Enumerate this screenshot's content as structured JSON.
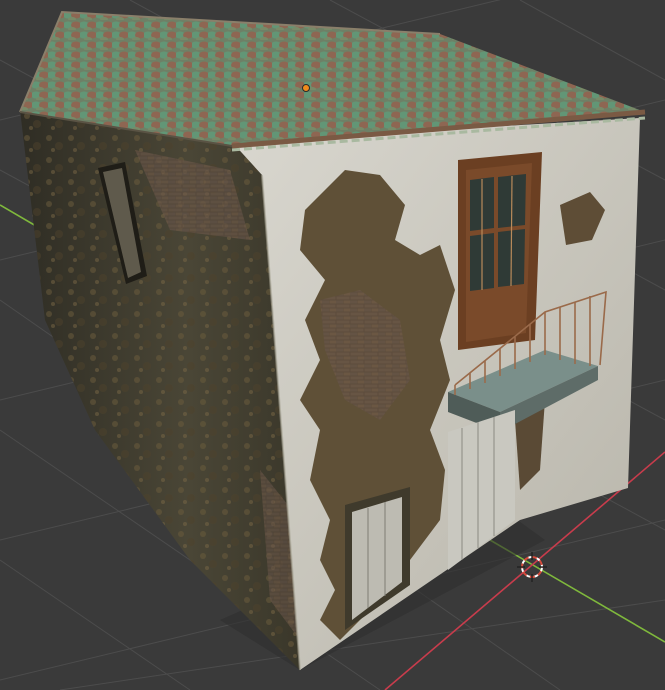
{
  "viewport": {
    "background": "#3a3a3a",
    "grid_color": "#4a4a4a",
    "x_axis_color": "#c83c4c",
    "y_axis_color": "#7fb83c"
  },
  "model": {
    "roof_color": "#6d8c6e",
    "wall_color": "#cfcdc4",
    "side_wall_color": "#3f3d30",
    "origin_color": "#f08a1c"
  },
  "cursor": {
    "ring_color": "#d64a3a"
  }
}
